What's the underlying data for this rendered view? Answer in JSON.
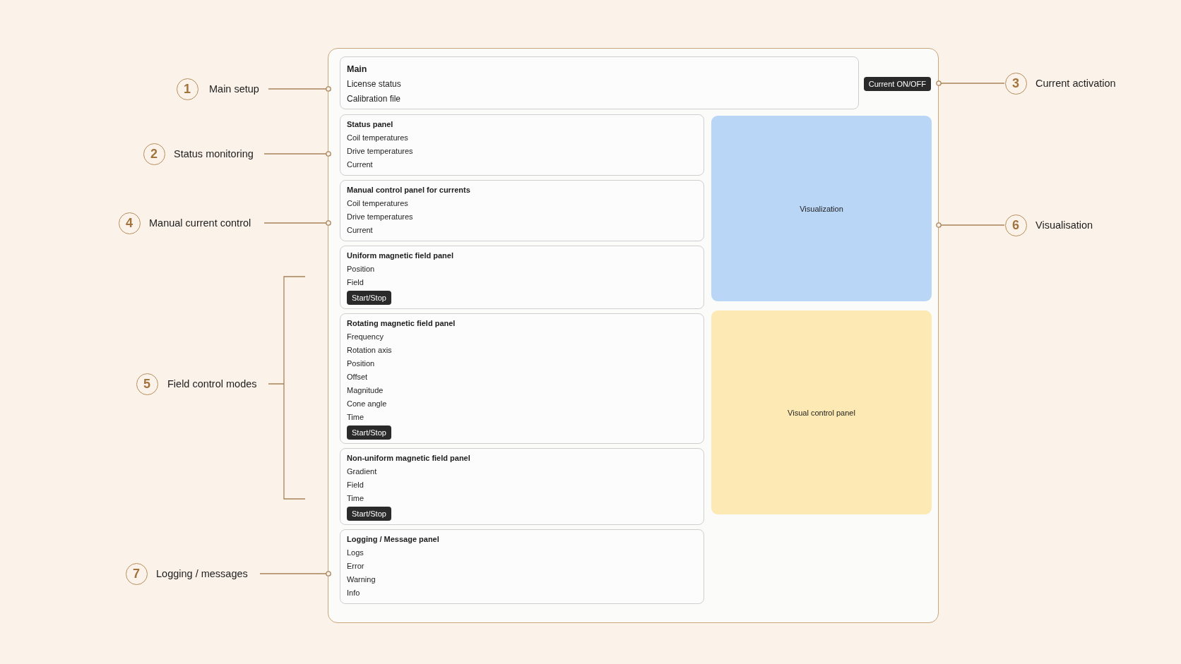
{
  "main": {
    "title": "Main",
    "items": [
      "License status",
      "Calibration file"
    ]
  },
  "current_button": "Current ON/OFF",
  "panels": [
    {
      "title": "Status panel",
      "items": [
        "Coil temperatures",
        "Drive temperatures",
        "Current"
      ]
    },
    {
      "title": "Manual control panel for currents",
      "items": [
        "Coil temperatures",
        "Drive temperatures",
        "Current"
      ]
    },
    {
      "title": "Uniform magnetic field panel",
      "items": [
        "Position",
        "Field"
      ],
      "button": "Start/Stop"
    },
    {
      "title": "Rotating magnetic field panel",
      "items": [
        "Frequency",
        "Rotation axis",
        "Position",
        "Offset",
        "Magnitude",
        "Cone angle",
        "Time"
      ],
      "button": "Start/Stop"
    },
    {
      "title": "Non-uniform magnetic field panel",
      "items": [
        "Gradient",
        "Field",
        "Time"
      ],
      "button": "Start/Stop"
    },
    {
      "title": "Logging / Message panel",
      "items": [
        "Logs",
        "Error",
        "Warning",
        "Info"
      ]
    }
  ],
  "areas": [
    {
      "label": "Visualization",
      "color": "#b9d6f6"
    },
    {
      "label": "Visual control panel",
      "color": "#fde9b3"
    }
  ],
  "left_callouts": [
    {
      "number": "1",
      "label": "Main setup",
      "kind": "line"
    },
    {
      "number": "2",
      "label": "Status monitoring",
      "kind": "line"
    },
    {
      "number": "4",
      "label": "Manual current control",
      "kind": "line"
    },
    {
      "number": "5",
      "label": "Field control modes",
      "kind": "bracket"
    },
    {
      "number": "7",
      "label": "Logging / messages",
      "kind": "line"
    }
  ],
  "right_callouts": [
    {
      "number": "3",
      "label": "Current activation",
      "kind": "line"
    },
    {
      "number": "6",
      "label": "Visualisation",
      "kind": "line"
    }
  ]
}
